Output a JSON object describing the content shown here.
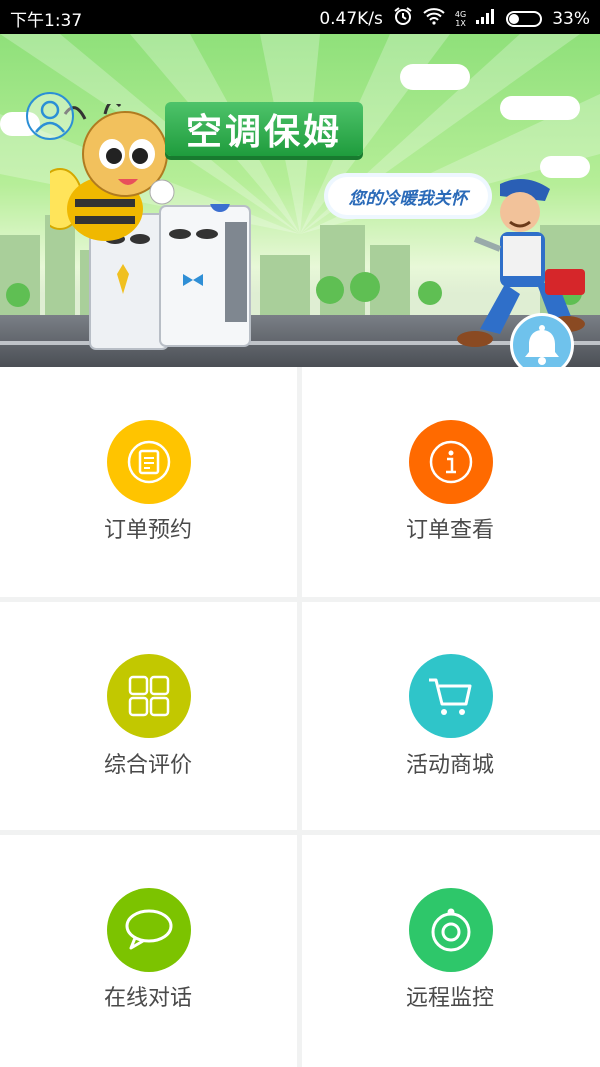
{
  "status_bar": {
    "time": "下午1:37",
    "network_speed": "0.47K/s",
    "network_type_top": "4G",
    "network_type_bottom": "1X",
    "battery_percent": "33%",
    "battery_level": 0.33
  },
  "banner": {
    "title": "空调保姆",
    "slogan": "您的冷暖我关怀"
  },
  "menu": {
    "items": [
      {
        "label": "订单预约",
        "icon": "document-icon",
        "color": "#ffc400"
      },
      {
        "label": "订单查看",
        "icon": "info-icon",
        "color": "#ff6a00"
      },
      {
        "label": "综合评价",
        "icon": "grid-icon",
        "color": "#c2c800"
      },
      {
        "label": "活动商城",
        "icon": "cart-icon",
        "color": "#2fc5c9"
      },
      {
        "label": "在线对话",
        "icon": "chat-icon",
        "color": "#7cc300"
      },
      {
        "label": "远程监控",
        "icon": "monitor-icon",
        "color": "#2ec76a"
      }
    ]
  }
}
